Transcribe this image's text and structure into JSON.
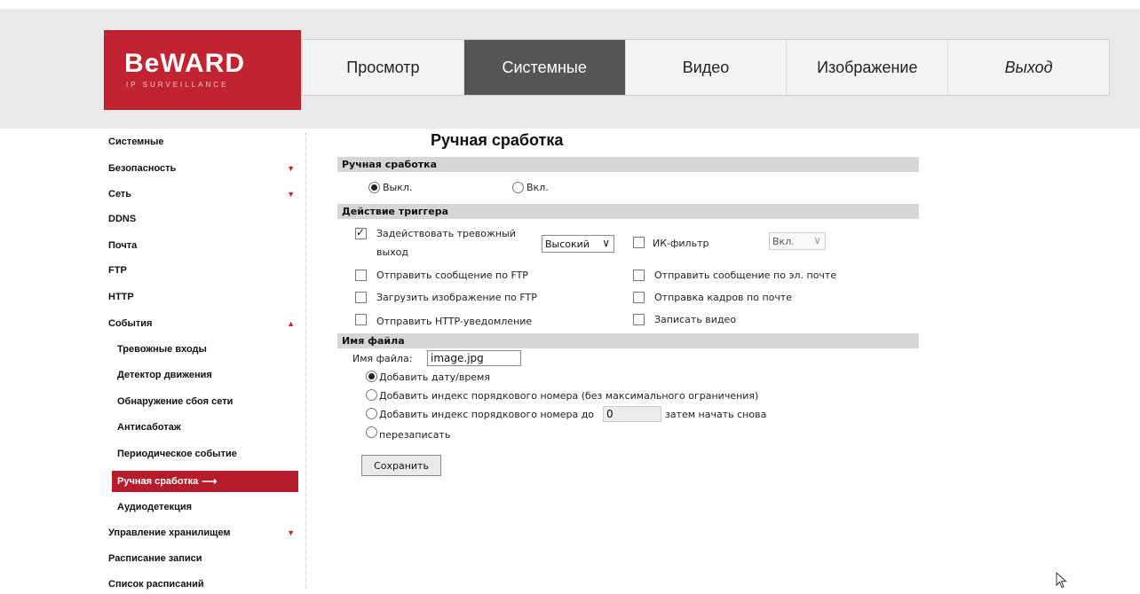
{
  "logo": {
    "brand": "BeWARD",
    "tagline": "IP SURVEILLANCE"
  },
  "nav": {
    "tabs": [
      {
        "label": "Просмотр",
        "active": false
      },
      {
        "label": "Системные",
        "active": true
      },
      {
        "label": "Видео",
        "active": false
      },
      {
        "label": "Изображение",
        "active": false
      },
      {
        "label": "Выход",
        "active": false
      }
    ]
  },
  "sidebar": {
    "items": [
      {
        "label": "Системные"
      },
      {
        "label": "Безопасность",
        "arrow": "▼"
      },
      {
        "label": "Сеть",
        "arrow": "▼"
      },
      {
        "label": "DDNS"
      },
      {
        "label": "Почта"
      },
      {
        "label": "FTP"
      },
      {
        "label": "HTTP"
      },
      {
        "label": "События",
        "arrow": "▲"
      },
      {
        "label": "Тревожные входы"
      },
      {
        "label": "Детектор движения"
      },
      {
        "label": "Обнаружение сбоя сети"
      },
      {
        "label": "Антисаботаж"
      },
      {
        "label": "Периодическое событие"
      },
      {
        "label": "Ручная сработка",
        "arrow": "⟶"
      },
      {
        "label": "Аудиодетекция"
      },
      {
        "label": "Управление хранилищем",
        "arrow": "▼"
      },
      {
        "label": "Расписание записи"
      },
      {
        "label": "Список расписаний"
      }
    ]
  },
  "main": {
    "page_title": "Ручная сработка",
    "manual": {
      "header": "Ручная сработка",
      "off_label": "Выкл.",
      "on_label": "Вкл.",
      "selected": "off"
    },
    "trigger": {
      "header": "Действие триггера",
      "alarm_output_line1": "Задействовать тревожный",
      "alarm_output_line2": "выход",
      "alarm_output_checked": true,
      "alarm_level": "Высокий",
      "ir_filter_label": "ИК-фильтр",
      "ir_filter_value": "Вкл.",
      "ftp_message": "Отправить сообщение по FTP",
      "email_message": "Отправить сообщение по эл. почте",
      "ftp_upload": "Загрузить изображение по FTP",
      "mail_frames": "Отправка кадров по почте",
      "http_notify": "Отправить HTTP-уведомление",
      "record_video": "Записать видео"
    },
    "filename": {
      "header": "Имя файла",
      "label": "Имя файла:",
      "value": "image.jpg",
      "opt_datetime": "Добавить дату/время",
      "opt_index_unlimited": "Добавить индекс порядкового номера (без максимального ограничения)",
      "opt_index_upto": "Добавить индекс порядкового номера до",
      "upto_value": "0",
      "opt_restart": "затем начать снова",
      "opt_overwrite": "перезаписать"
    },
    "save_label": "Сохранить"
  }
}
